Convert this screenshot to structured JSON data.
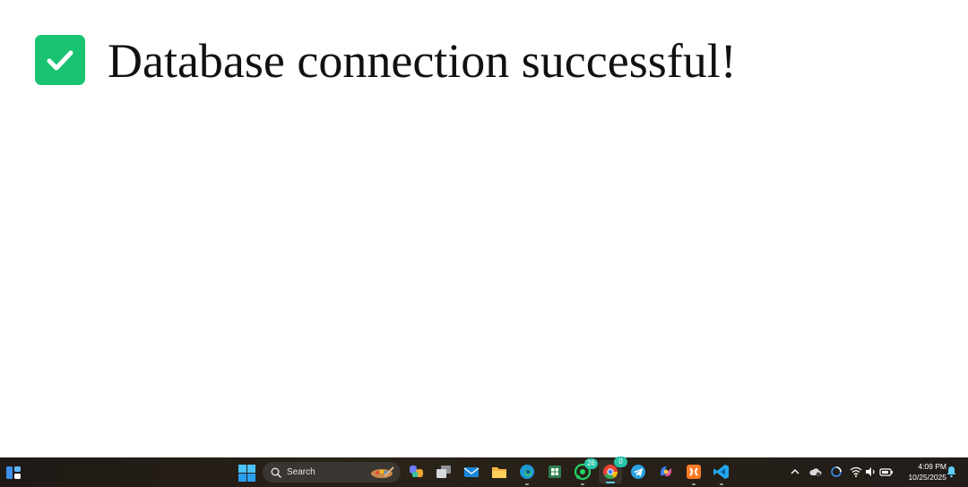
{
  "message": {
    "icon": "check-icon",
    "text": "Database connection successful!",
    "icon_color": "#19c36f"
  },
  "taskbar": {
    "search_label": "Search",
    "apps": [
      {
        "name": "copilot-icon"
      },
      {
        "name": "task-view-icon"
      },
      {
        "name": "mail-icon"
      },
      {
        "name": "file-explorer-icon"
      },
      {
        "name": "edge-icon"
      },
      {
        "name": "spreadsheet-icon"
      },
      {
        "name": "whatsapp-icon",
        "badge": "26"
      },
      {
        "name": "chrome-icon",
        "badge": "0"
      },
      {
        "name": "telegram-icon"
      },
      {
        "name": "microsoft-365-icon"
      },
      {
        "name": "xampp-icon"
      },
      {
        "name": "vscode-icon"
      }
    ],
    "clock": {
      "time": "4:09 PM",
      "date": "10/25/2025"
    }
  }
}
